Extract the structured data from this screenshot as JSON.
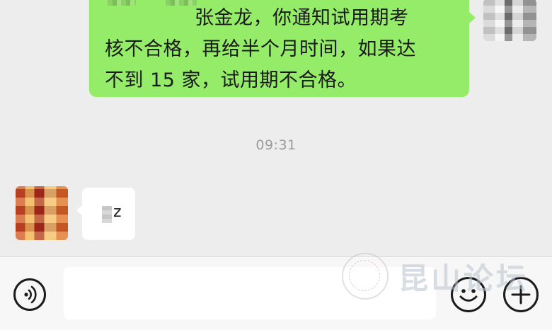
{
  "chat": {
    "outgoing_message": {
      "lines": [
        "张金龙，你通知试用期考",
        "核不合格，再给半个月时间，如果达",
        "不到 15 家，试用期不合格。"
      ]
    },
    "timestamp": "09:31",
    "incoming_message": {
      "text": "z"
    }
  },
  "input_bar": {
    "voice_icon": "voice-icon",
    "text_value": "",
    "emoji_icon": "emoji-icon",
    "plus_icon": "plus-icon"
  },
  "watermark": {
    "text": "昆山论坛"
  },
  "colors": {
    "chat_background": "#ededed",
    "outgoing_bubble": "#95ec69",
    "incoming_bubble": "#ffffff",
    "timestamp_text": "#9b9b9b",
    "input_bar_background": "#f7f7f7"
  }
}
